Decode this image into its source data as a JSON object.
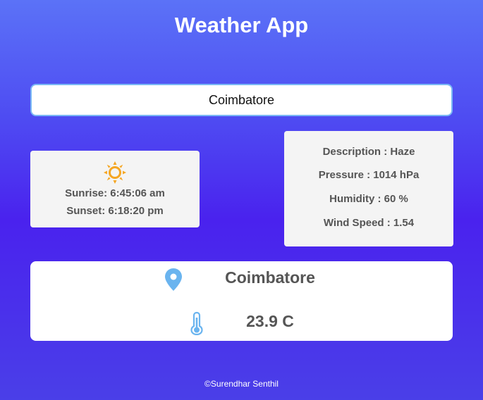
{
  "app": {
    "title": "Weather App"
  },
  "search": {
    "value": "Coimbatore"
  },
  "sun": {
    "icon": "sun-icon",
    "sunrise": "Sunrise: 6:45:06 am",
    "sunset": "Sunset: 6:18:20 pm"
  },
  "details": {
    "description": "Description : Haze",
    "pressure": "Pressure : 1014 hPa",
    "humidity": "Humidity : 60 %",
    "wind_speed": "Wind Speed : 1.54"
  },
  "current": {
    "location_icon": "location-pin-icon",
    "location": "Coimbatore",
    "temperature_icon": "thermometer-icon",
    "temperature": "23.9 C"
  },
  "footer": {
    "text": "©Surendhar Senthil"
  },
  "colors": {
    "accent": "#7ab8f5",
    "sun": "#f5a623",
    "card": "#f4f4f4",
    "text": "#555555"
  }
}
